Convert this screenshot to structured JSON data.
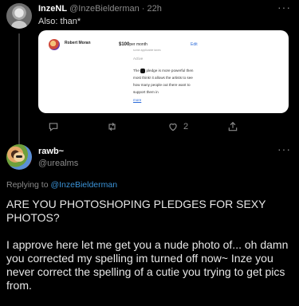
{
  "tweet1": {
    "name": "InzeNL",
    "handle": "@InzeBielderman",
    "separator": "·",
    "time": "22h",
    "text": "Also: than*",
    "more": "···",
    "card": {
      "name": "Robert Moran",
      "price_amount": "$100",
      "price_period": "per month",
      "sub": "some applicable taxes",
      "edit": "Edit",
      "status": "Active",
      "desc_before": "The",
      "desc_after": "pledge is more powerful then most think! it allows the artists to see how many people out there want to support them in",
      "more_link": "more"
    },
    "actions": {
      "retweets": "",
      "likes": "2"
    }
  },
  "tweet2": {
    "name": "rawb~",
    "handle": "@urealms",
    "more": "···",
    "reply_prefix": "Replying to ",
    "reply_mention": "@InzeBielderman",
    "text": "ARE YOU PHOTOSHOPING PLEDGES FOR SEXY PHOTOS?\n\nI approve here let me get you a nude photo of... oh damn you corrected my spelling im turned off now~ Inze you never correct the spelling of a cutie you trying to get pics from."
  },
  "colors": {
    "background": "#000000",
    "link": "#3b94d9",
    "muted": "#8b8b8b",
    "text": "#e7e7e7"
  }
}
